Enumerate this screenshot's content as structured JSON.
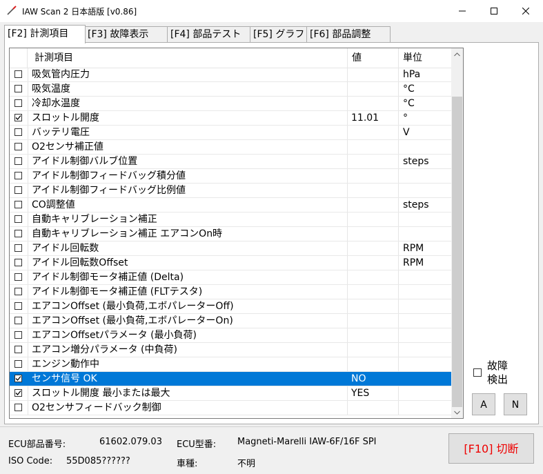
{
  "window": {
    "title": "IAW Scan 2 日本語版 [v0.86]",
    "minimize": "—",
    "maximize": "☐",
    "close": "✕"
  },
  "tabs": [
    {
      "label": "[F2] 計測項目",
      "active": true
    },
    {
      "label": "[F3] 故障表示",
      "active": false
    },
    {
      "label": "[F4] 部品テスト",
      "active": false
    },
    {
      "label": "[F5] グラフ",
      "active": false
    },
    {
      "label": "[F6] 部品調整",
      "active": false
    }
  ],
  "table": {
    "headers": {
      "item": "計測項目",
      "value": "値",
      "unit": "単位"
    },
    "rows": [
      {
        "checked": false,
        "name": "吸気管内圧力",
        "value": "",
        "unit": "hPa"
      },
      {
        "checked": false,
        "name": "吸気温度",
        "value": "",
        "unit": "°C"
      },
      {
        "checked": false,
        "name": "冷却水温度",
        "value": "",
        "unit": "°C"
      },
      {
        "checked": true,
        "name": "スロットル開度",
        "value": "11.01",
        "unit": "°"
      },
      {
        "checked": false,
        "name": "バッテリ電圧",
        "value": "",
        "unit": "V"
      },
      {
        "checked": false,
        "name": "O2センサ補正値",
        "value": "",
        "unit": ""
      },
      {
        "checked": false,
        "name": "アイドル制御バルブ位置",
        "value": "",
        "unit": "steps"
      },
      {
        "checked": false,
        "name": "アイドル制御フィードバッグ積分値",
        "value": "",
        "unit": ""
      },
      {
        "checked": false,
        "name": "アイドル制御フィードバッグ比例値",
        "value": "",
        "unit": ""
      },
      {
        "checked": false,
        "name": "CO調整値",
        "value": "",
        "unit": "steps"
      },
      {
        "checked": false,
        "name": "自動キャリブレーション補正",
        "value": "",
        "unit": ""
      },
      {
        "checked": false,
        "name": "自動キャリブレーション補正 エアコンOn時",
        "value": "",
        "unit": ""
      },
      {
        "checked": false,
        "name": "アイドル回転数",
        "value": "",
        "unit": "RPM"
      },
      {
        "checked": false,
        "name": "アイドル回転数Offset",
        "value": "",
        "unit": "RPM"
      },
      {
        "checked": false,
        "name": "アイドル制御モータ補正値 (Delta)",
        "value": "",
        "unit": ""
      },
      {
        "checked": false,
        "name": "アイドル制御モータ補正値 (FLTテスタ)",
        "value": "",
        "unit": ""
      },
      {
        "checked": false,
        "name": "エアコンOffset (最小負荷,エボパレーターOff)",
        "value": "",
        "unit": ""
      },
      {
        "checked": false,
        "name": "エアコンOffset (最小負荷,エボパレーターOn)",
        "value": "",
        "unit": ""
      },
      {
        "checked": false,
        "name": "エアコンOffsetパラメータ (最小負荷)",
        "value": "",
        "unit": ""
      },
      {
        "checked": false,
        "name": "エアコン増分パラメータ (中負荷)",
        "value": "",
        "unit": ""
      },
      {
        "checked": false,
        "name": "エンジン動作中",
        "value": "",
        "unit": ""
      },
      {
        "checked": true,
        "selected": true,
        "name": "センサ信号 OK",
        "value": "NO",
        "unit": ""
      },
      {
        "checked": true,
        "name": "スロットル開度 最小または最大",
        "value": "YES",
        "unit": ""
      },
      {
        "checked": false,
        "name": "O2センサフィードバック制御",
        "value": "",
        "unit": ""
      }
    ]
  },
  "side": {
    "fault_detect_label": "故障\n検出",
    "btn_a": "A",
    "btn_n": "N"
  },
  "status": {
    "ecu_part_label": "ECU部品番号:",
    "ecu_part_value": "61602.079.03",
    "ecu_type_label": "ECU型番:",
    "ecu_type_value": "Magneti-Marelli IAW-6F/16F SPI",
    "iso_label": "ISO Code:",
    "iso_value": "55D085??????",
    "vehicle_label": "車種:",
    "vehicle_value": "不明",
    "disconnect": "[F10] 切断"
  },
  "colors": {
    "selection": "#0078d7",
    "disconnect_text": "#e00000"
  }
}
